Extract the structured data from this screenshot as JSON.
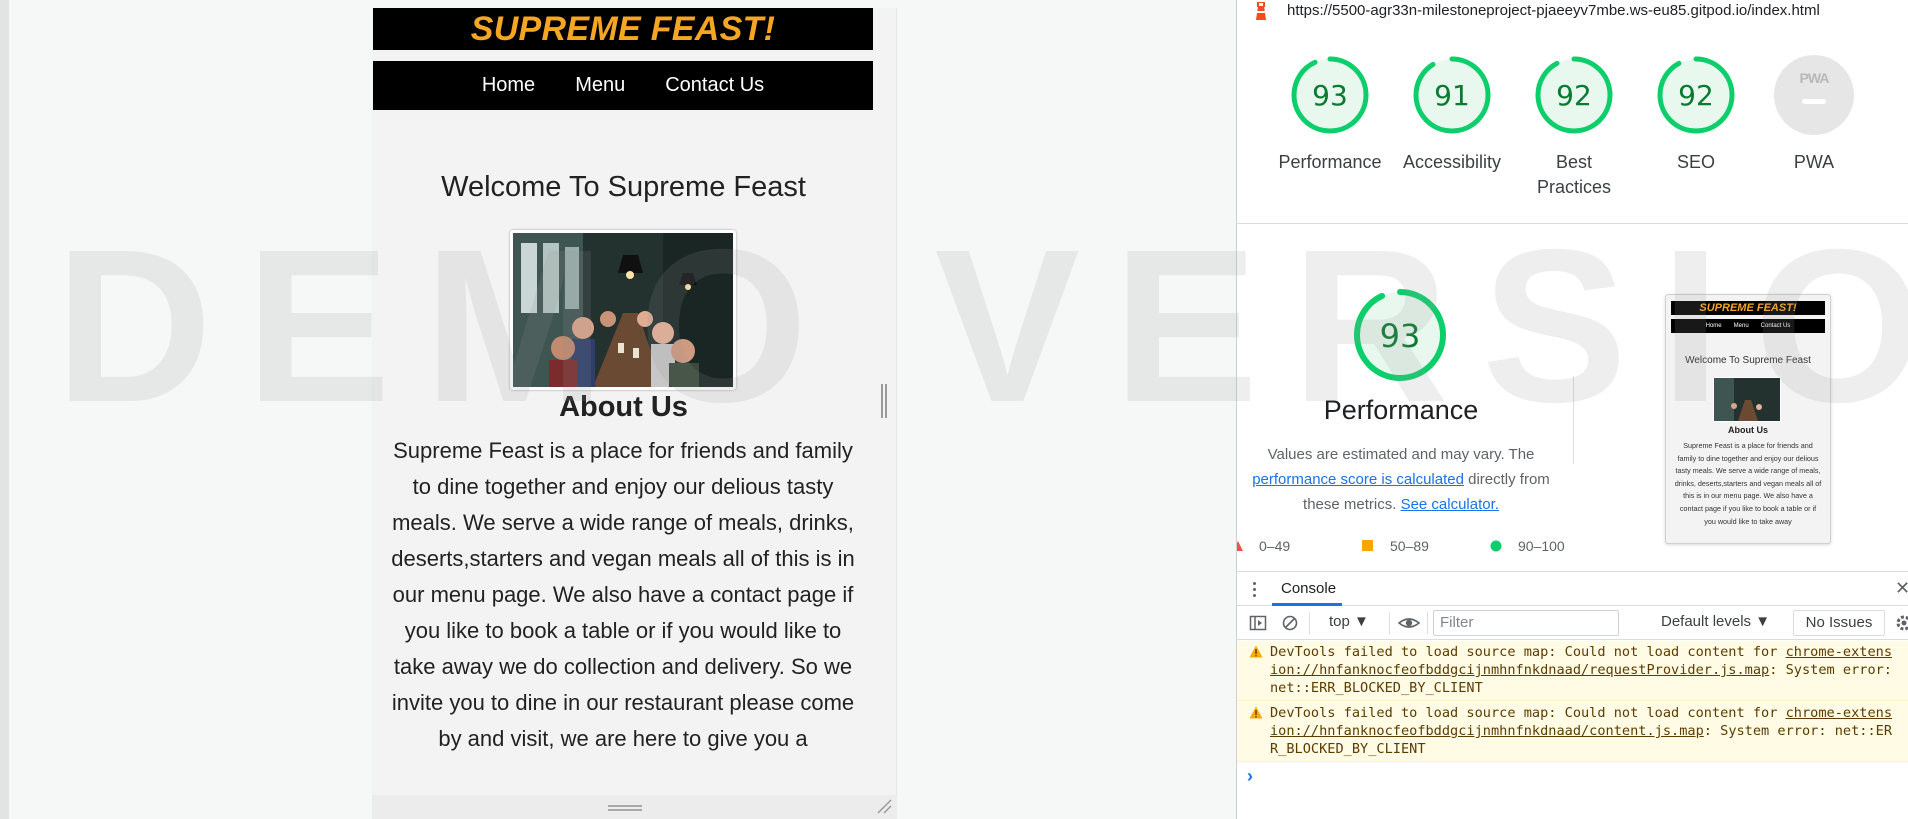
{
  "site": {
    "header_title": "SUPREME FEAST!",
    "nav": [
      "Home",
      "Menu",
      "Contact Us"
    ],
    "welcome_heading": "Welcome To Supreme Feast",
    "about_heading": "About Us",
    "about_text": "Supreme Feast is a place for friends and family to dine together and enjoy our delious tasty meals. We serve a wide range of meals, drinks, deserts,starters and vegan meals all of this is in our menu page. We also have a contact page if you like to book a table or if you would like to take away we do collection and delivery. So we invite you to dine in our restaurant please come by and visit, we are here to give you a",
    "thumb_text": "Supreme Feast is a place for friends and family to dine together and enjoy our delious tasty meals. We serve a wide range of meals, drinks, deserts,starters and vegan meals all of this is in our menu page. We also have a contact page if you like to book a table or if you would like to take away"
  },
  "watermark": "DEMO VERSION",
  "lighthouse": {
    "url": "https://5500-agr33n-milestoneproject-pjaeeyv7mbe.ws-eu85.gitpod.io/index.html",
    "scores": [
      {
        "label": "Performance",
        "value": "93",
        "score": 93
      },
      {
        "label": "Accessibility",
        "value": "91",
        "score": 91
      },
      {
        "label": "Best Practices",
        "value": "92",
        "score": 92
      },
      {
        "label": "SEO",
        "value": "92",
        "score": 92
      }
    ],
    "pwa_label": "PWA",
    "pwa_badge_text": "PWA",
    "performance": {
      "value": "93",
      "score": 93,
      "title": "Performance",
      "desc_1": "Values are estimated and may vary. The",
      "desc_link": "performance score is calculated",
      "desc_2": " directly from these metrics. ",
      "desc_link2": "See calculator."
    },
    "legend": [
      "0–49",
      "50–89",
      "90–100"
    ],
    "colors": {
      "pass": "#0cce6b",
      "average": "#ffa400",
      "fail": "#ff4e42"
    }
  },
  "console": {
    "tab_label": "Console",
    "context": "top ▼",
    "filter_placeholder": "Filter",
    "levels": "Default levels ▼",
    "issues": "No Issues",
    "messages": [
      {
        "prefix": "DevTools failed to load source map: Could not load content for ",
        "link": "chrome-extension://hnfanknocfeofbddgcijnmhnfnkdnaad/requestProvider.js.map",
        "suffix": ": System error: net::ERR_BLOCKED_BY_CLIENT"
      },
      {
        "prefix": "DevTools failed to load source map: Could not load content for ",
        "link": "chrome-extension://hnfanknocfeofbddgcijnmhnfnkdnaad/content.js.map",
        "suffix": ": System error: net::ERR_BLOCKED_BY_CLIENT"
      }
    ],
    "prompt": "›"
  }
}
